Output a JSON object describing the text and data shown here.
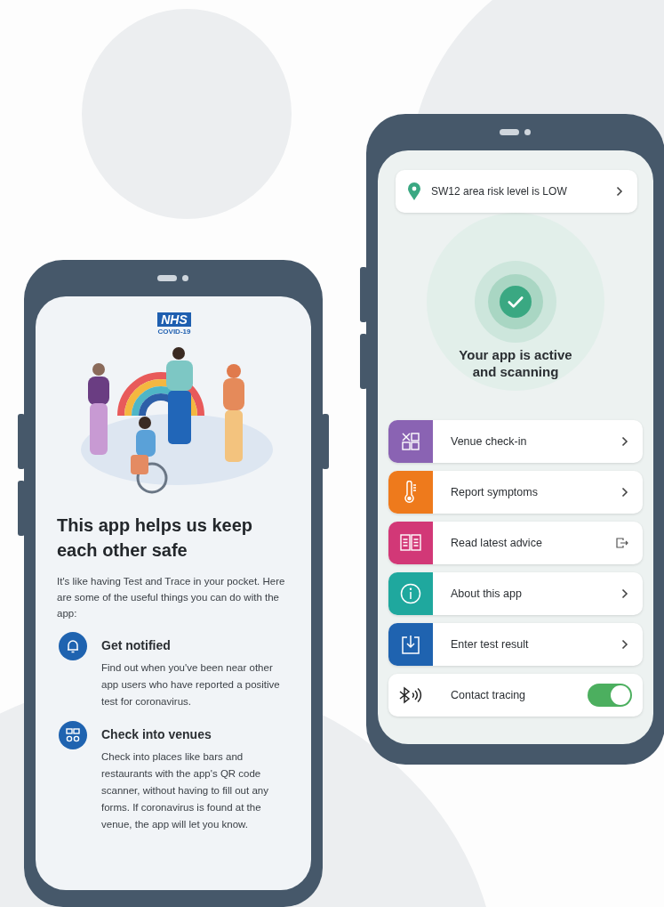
{
  "left_screen": {
    "logo": {
      "brand": "NHS",
      "subtitle": "COVID-19"
    },
    "heading": "This app helps us keep each other safe",
    "intro": "It's like having Test and Trace in your pocket. Here are some of the useful things you can do with the app:",
    "features": [
      {
        "title": "Get notified",
        "text": "Find out when you've been near other app users who have reported a positive test for coronavirus."
      },
      {
        "title": "Check into venues",
        "text": "Check into places like bars and restaurants with the app's QR code scanner, without having to fill out any forms. If coronavirus is found at the venue, the app will let you know."
      }
    ]
  },
  "right_screen": {
    "risk_banner": "SW12 area risk level is LOW",
    "status": "Your app is active and scanning",
    "menu": [
      {
        "kind": "link",
        "label": "Venue check-in",
        "color": "#8a63b3"
      },
      {
        "kind": "link",
        "label": "Report symptoms",
        "color": "#ee7a1c"
      },
      {
        "kind": "link",
        "label": "Read latest advice",
        "color": "#d23877"
      },
      {
        "kind": "link",
        "label": "About this app",
        "color": "#1fa89e"
      },
      {
        "kind": "link",
        "label": "Enter test result",
        "color": "#1f63b0"
      },
      {
        "kind": "toggle",
        "label": "Contact tracing",
        "on": true
      }
    ]
  }
}
